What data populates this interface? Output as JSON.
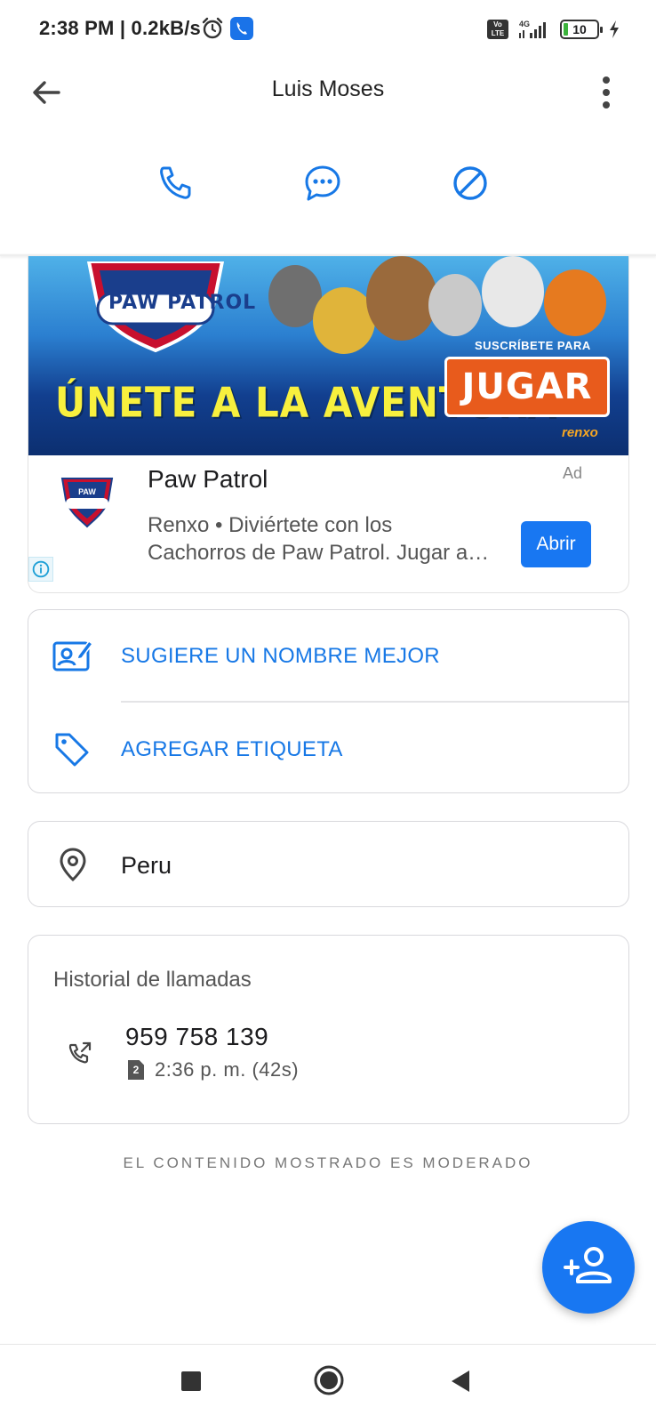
{
  "status_bar": {
    "time_speed": "2:38 PM | 0.2kB/s",
    "volte": "Vo LTE",
    "network": "4G",
    "battery": "10"
  },
  "header": {
    "title": "Luis Moses"
  },
  "actions": [
    "phone-icon",
    "message-icon",
    "block-icon"
  ],
  "ad": {
    "banner": {
      "logo_text": "PAW PATROL",
      "headline": "ÚNETE A LA AVENTURA",
      "cta_caption": "SUSCRÍBETE PARA",
      "cta": "JUGAR",
      "brand": "renxo"
    },
    "title": "Paw Patrol",
    "label": "Ad",
    "description_line1": "Renxo • Diviértete con los",
    "description_line2": "Cachorros de Paw Patrol. Jugar a…",
    "button": "Abrir"
  },
  "options": {
    "suggest_name": "SUGIERE UN NOMBRE MEJOR",
    "add_tag": "AGREGAR ETIQUETA"
  },
  "location": {
    "country": "Peru"
  },
  "call_history": {
    "title": "Historial de llamadas",
    "number": "959 758 139",
    "sim": "2",
    "time": "2:36 p. m. (42s)"
  },
  "footer_note": "EL CONTENIDO MOSTRADO ES MODERADO",
  "colors": {
    "accent": "#1778e6",
    "fab": "#1877f2"
  }
}
